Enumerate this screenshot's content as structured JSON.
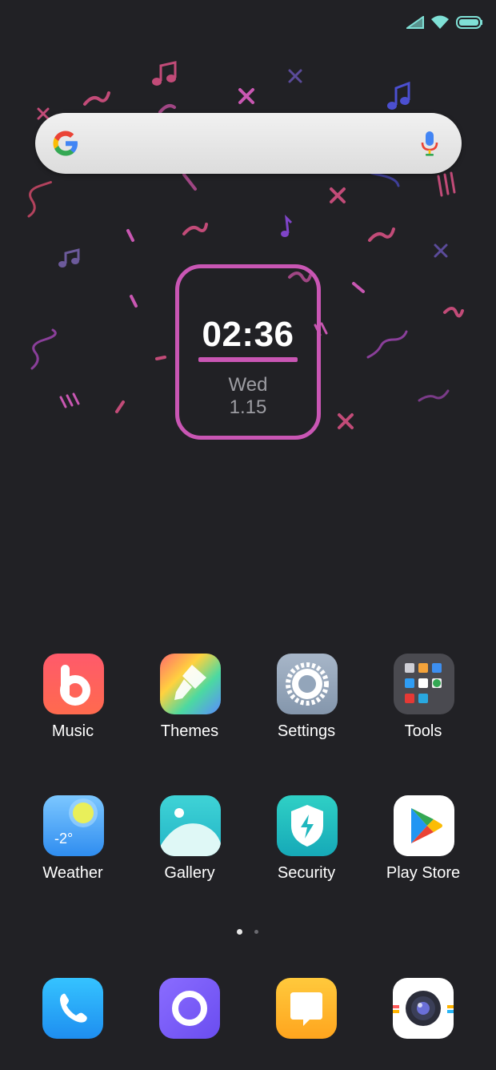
{
  "status_bar": {
    "icons": [
      "cellular-signal-icon",
      "wifi-icon",
      "battery-icon"
    ],
    "accent": "#7fe0d6"
  },
  "search_widget": {
    "left_icon": "google-g-icon",
    "right_icon": "microphone-icon"
  },
  "clock": {
    "time": "02:36",
    "day": "Wed",
    "date": "1.15",
    "accent": "#c956b4"
  },
  "home_grid": [
    {
      "label": "Music",
      "icon": "music-app-icon"
    },
    {
      "label": "Themes",
      "icon": "themes-app-icon"
    },
    {
      "label": "Settings",
      "icon": "settings-gear-icon"
    },
    {
      "label": "Tools",
      "icon": "tools-folder-icon"
    },
    {
      "label": "Weather",
      "icon": "weather-app-icon",
      "temperature": "-2°"
    },
    {
      "label": "Gallery",
      "icon": "gallery-app-icon"
    },
    {
      "label": "Security",
      "icon": "security-shield-icon"
    },
    {
      "label": "Play Store",
      "icon": "play-store-icon"
    }
  ],
  "page_indicator": {
    "pages": 2,
    "current": 1
  },
  "dock": [
    {
      "icon": "phone-icon"
    },
    {
      "icon": "browser-icon"
    },
    {
      "icon": "messages-icon"
    },
    {
      "icon": "camera-icon"
    }
  ],
  "colors": {
    "background": "#212125",
    "label_text": "#ffffff"
  }
}
